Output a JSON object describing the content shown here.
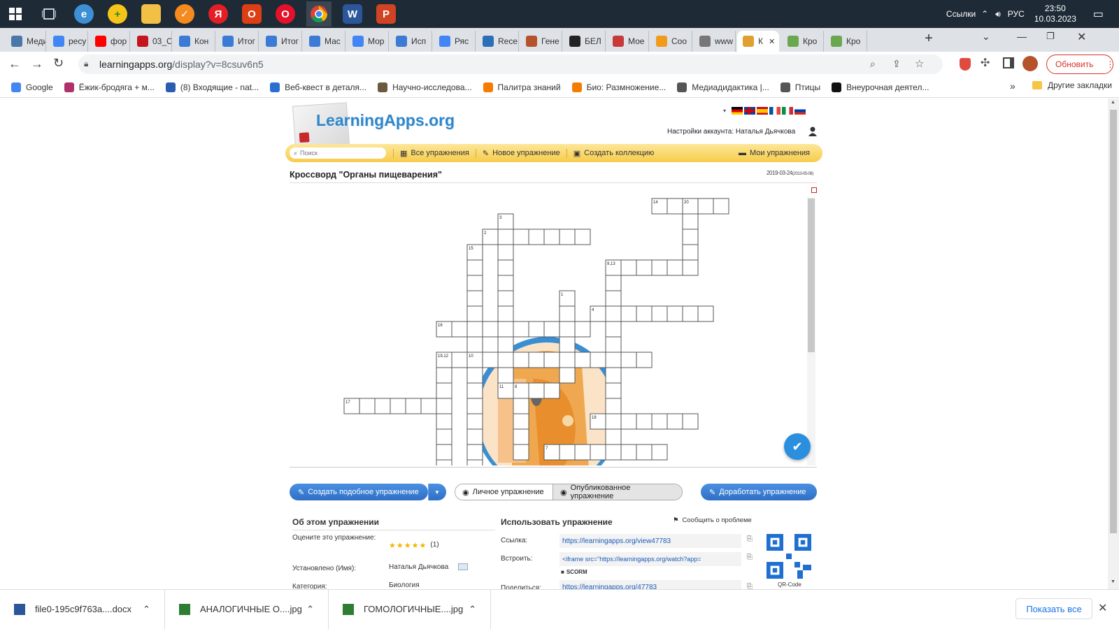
{
  "taskbar": {
    "lang_links": "Ссылки",
    "lang": "РУС",
    "time": "23:50",
    "date": "10.03.2023"
  },
  "tabs": [
    {
      "label": "Меди",
      "color": "#4a76a8"
    },
    {
      "label": "ресу",
      "color": "#4285f4"
    },
    {
      "label": "фор",
      "color": "#ff0000"
    },
    {
      "label": "03_С",
      "color": "#c4141c"
    },
    {
      "label": "Кон",
      "color": "#3b7bd6"
    },
    {
      "label": "Итог",
      "color": "#3b7bd6"
    },
    {
      "label": "Итог",
      "color": "#3b7bd6"
    },
    {
      "label": "Мас",
      "color": "#3b7bd6"
    },
    {
      "label": "Мор",
      "color": "#4285f4"
    },
    {
      "label": "Исп",
      "color": "#3b7bd6"
    },
    {
      "label": "Ряс",
      "color": "#4285f4"
    },
    {
      "label": "Rece",
      "color": "#2d6fb6"
    },
    {
      "label": "Гене",
      "color": "#b5522b"
    },
    {
      "label": "БЕЛ",
      "color": "#222222"
    },
    {
      "label": "Мое",
      "color": "#c83a3a"
    },
    {
      "label": "Coo",
      "color": "#f29b1b"
    },
    {
      "label": "www",
      "color": "#777777"
    },
    {
      "label": "К",
      "color": "#e0a030"
    },
    {
      "label": "Кро",
      "color": "#6aa84f"
    },
    {
      "label": "Кро",
      "color": "#6aa84f"
    }
  ],
  "address": {
    "url_host": "learningapps.org",
    "url_path": "/display?v=8csuv6n5",
    "update_label": "Обновить"
  },
  "bookmarks": [
    {
      "label": "Google",
      "color": "#4285f4"
    },
    {
      "label": "Ёжик-бродяга + м...",
      "color": "#b0306a"
    },
    {
      "label": "(8) Входящие - nat...",
      "color": "#2a5db0"
    },
    {
      "label": "Веб-квест в деталя...",
      "color": "#2a6fd0"
    },
    {
      "label": "Научно-исследова...",
      "color": "#6b5a40"
    },
    {
      "label": "Палитра знаний",
      "color": "#f57c00"
    },
    {
      "label": "Био: Размножение...",
      "color": "#f57c00"
    },
    {
      "label": "Медиадидактика |...",
      "color": "#555555"
    },
    {
      "label": "Птицы",
      "color": "#555555"
    },
    {
      "label": "Внеурочная деятел...",
      "color": "#111111"
    }
  ],
  "bookmarks_more": "»",
  "other_bookmarks": "Другие закладки",
  "la": {
    "logo": "LearningApps.org",
    "account": "Настройки аккаунта: Наталья Дьячкова",
    "search_placeholder": "Поиск",
    "nav": [
      "Все упражнения",
      "Новое упражнение",
      "Создать коллекцию"
    ],
    "nav_mine": "Мои упражнения",
    "title": "Кроссворд \"Органы пищеварения\"",
    "date": "2019-03-24",
    "date_small": "(2013-05-08)"
  },
  "buttons": {
    "create_similar": "Создать подобное упражнение",
    "private": "Личное упражнение",
    "published": "Опубликованное упражнение",
    "improve": "Доработать упражнение"
  },
  "about": {
    "title": "Об этом упражнении",
    "rate_label": "Оцените это упражнение:",
    "rating_count": "(1)",
    "author_label": "Установлено (Имя):",
    "author": "Наталья Дьячкова",
    "category_label": "Категория:",
    "category": "Биология"
  },
  "use": {
    "title": "Использовать упражнение",
    "report": "Сообщить о проблеме",
    "link_label": "Ссылка:",
    "link": "https://learningapps.org/view47783",
    "embed_label": "Встроить:",
    "embed": "<iframe src=\"https://learningapps.org/watch?app=",
    "scorm": "SCORM",
    "share_label": "Поделиться:",
    "share": "https://learningapps.org/47783",
    "qr_label": "QR-Code"
  },
  "downloads": [
    {
      "name": "file0-195c9f763a....docx",
      "color": "#2b579a"
    },
    {
      "name": "АНАЛОГИЧНЫЕ О....jpg",
      "color": "#2f7d32"
    },
    {
      "name": "ГОМОЛОГИЧНЫЕ....jpg",
      "color": "#2f7d32"
    }
  ],
  "show_all": "Показать все",
  "crossword": {
    "numbers": [
      "14",
      "20",
      "3",
      "2",
      "15",
      "9,13",
      "1",
      "4",
      "16",
      "19,12",
      "10",
      "11",
      "8",
      "17",
      "18",
      "7"
    ]
  }
}
